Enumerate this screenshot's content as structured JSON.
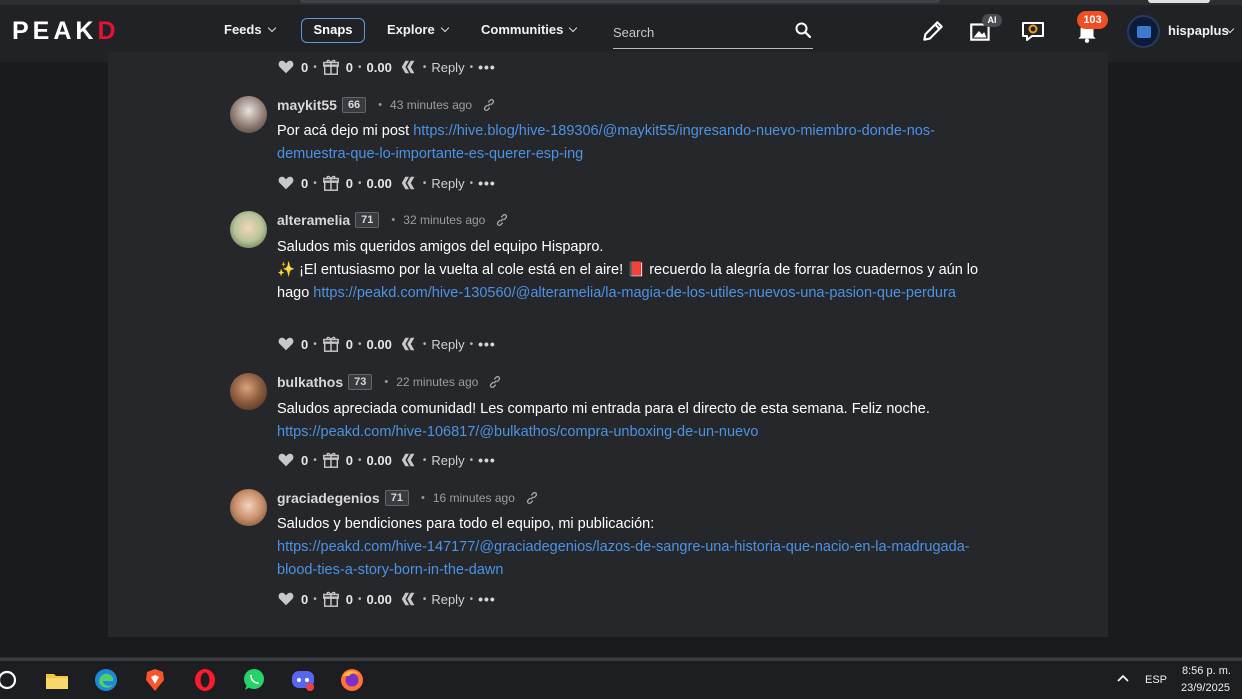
{
  "nav": {
    "logo_pre": "PEAK",
    "logo_d": "D",
    "feeds": "Feeds",
    "snaps": "Snaps",
    "explore": "Explore",
    "communities": "Communities",
    "search_placeholder": "Search",
    "ai_badge": "AI",
    "notif_count": "103",
    "username": "hispaplus"
  },
  "top_actions": {
    "votes": "0",
    "tips": "0",
    "amount": "0.00",
    "reply": "Reply",
    "more": "•••"
  },
  "comments": [
    {
      "user": "maykit55",
      "rep": "66",
      "time": "43 minutes ago",
      "text_pre": "Por acá dejo mi post ",
      "link": "https://hive.blog/hive-189306/@maykit55/ingresando-nuevo-miembro-donde-nos-demuestra-que-lo-importante-es-querer-esp-ing",
      "votes": "0",
      "tips": "0",
      "amount": "0.00",
      "reply": "Reply",
      "more": "•••"
    },
    {
      "user": "alteramelia",
      "rep": "71",
      "time": "32 minutes ago",
      "line1": "Saludos mis queridos amigos del equipo Hispapro.",
      "sparkle": "✨",
      "line2": " ¡El entusiasmo por la vuelta al cole está en el aire! ",
      "book": "📕",
      "line3": " recuerdo la alegría de forrar los cuadernos y aún lo hago ",
      "link": "https://peakd.com/hive-130560/@alteramelia/la-magia-de-los-utiles-nuevos-una-pasion-que-perdura",
      "votes": "0",
      "tips": "0",
      "amount": "0.00",
      "reply": "Reply",
      "more": "•••"
    },
    {
      "user": "bulkathos",
      "rep": "73",
      "time": "22 minutes ago",
      "line1": "Saludos apreciada comunidad! Les comparto mi entrada para el directo de esta semana. Feliz noche.",
      "link": "https://peakd.com/hive-106817/@bulkathos/compra-unboxing-de-un-nuevo",
      "votes": "0",
      "tips": "0",
      "amount": "0.00",
      "reply": "Reply",
      "more": "•••"
    },
    {
      "user": "graciadegenios",
      "rep": "71",
      "time": "16 minutes ago",
      "line1": "Saludos y bendiciones para todo el equipo, mi publicación:",
      "link": "https://peakd.com/hive-147177/@graciadegenios/lazos-de-sangre-una-historia-que-nacio-en-la-madrugada-blood-ties-a-story-born-in-the-dawn",
      "votes": "0",
      "tips": "0",
      "amount": "0.00",
      "reply": "Reply",
      "more": "•••"
    }
  ],
  "taskbar": {
    "lang": "ESP",
    "time": "8:56 p. m.",
    "date": "23/9/2025"
  },
  "colors": {
    "accent_link": "#4b93e5",
    "brand_red": "#e31337",
    "notif_orange": "#f04e23",
    "snaps_border": "#5b9bd5"
  }
}
